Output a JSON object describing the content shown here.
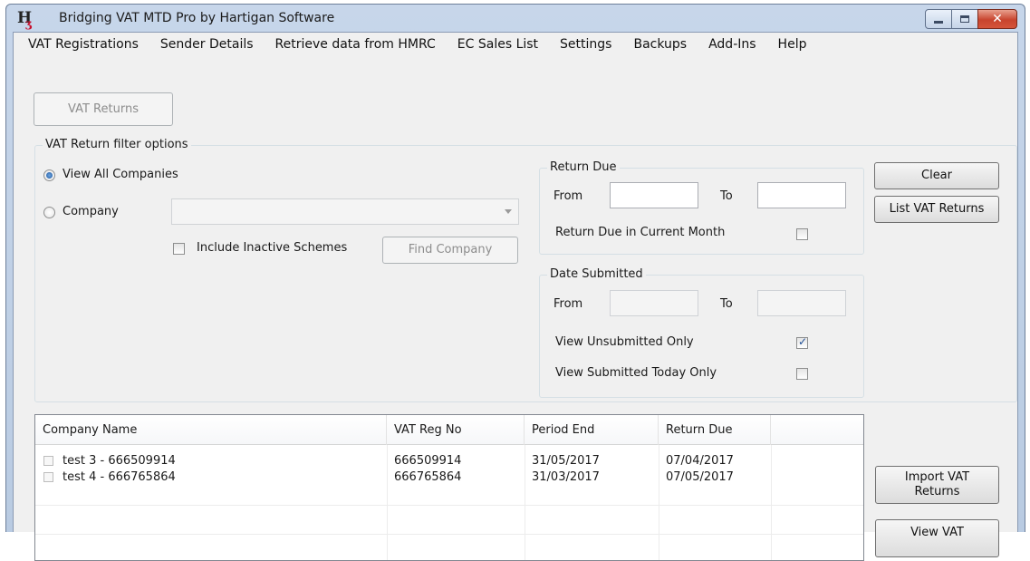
{
  "window": {
    "title": "Bridging VAT MTD Pro   by Hartigan Software",
    "logo_letters": "H"
  },
  "menu": [
    "VAT Registrations",
    "Sender Details",
    "Retrieve data from HMRC",
    "EC Sales List",
    "Settings",
    "Backups",
    "Add-Ins",
    "Help"
  ],
  "toolbar": {
    "vat_returns_label": "VAT Returns"
  },
  "filter": {
    "legend": "VAT Return filter options",
    "view_all_label": "View All Companies",
    "company_label": "Company",
    "company_value": "",
    "include_inactive_label": "Include Inactive Schemes",
    "find_company_label": "Find Company"
  },
  "return_due": {
    "legend": "Return Due",
    "from_label": "From",
    "to_label": "To",
    "from_value": "",
    "to_value": "",
    "current_month_label": "Return Due in Current Month"
  },
  "date_submitted": {
    "legend": "Date Submitted",
    "from_label": "From",
    "to_label": "To",
    "unsubmitted_label": "View Unsubmitted Only",
    "submitted_today_label": "View Submitted Today Only"
  },
  "actions": {
    "clear_label": "Clear",
    "list_label": "List VAT Returns",
    "import_line1": "Import VAT",
    "import_line2": "Returns",
    "view_partial": "View VAT"
  },
  "grid": {
    "headers": [
      "Company Name",
      "VAT Reg No",
      "Period End",
      "Return Due"
    ],
    "rows": [
      {
        "company": "test 3 - 666509914",
        "vat_reg": "666509914",
        "period_end": "31/05/2017",
        "return_due": "07/04/2017"
      },
      {
        "company": "test 4 - 666765864",
        "vat_reg": "666765864",
        "period_end": "31/03/2017",
        "return_due": "07/05/2017"
      }
    ]
  },
  "colors": {
    "title_bar": "#c7d6ea",
    "close_button": "#c8442e",
    "radio_selected": "#1c57a0"
  },
  "icons": [
    "app-logo",
    "minimize-icon",
    "maximize-icon",
    "close-icon",
    "dropdown-arrow-icon",
    "checkmark-icon"
  ]
}
